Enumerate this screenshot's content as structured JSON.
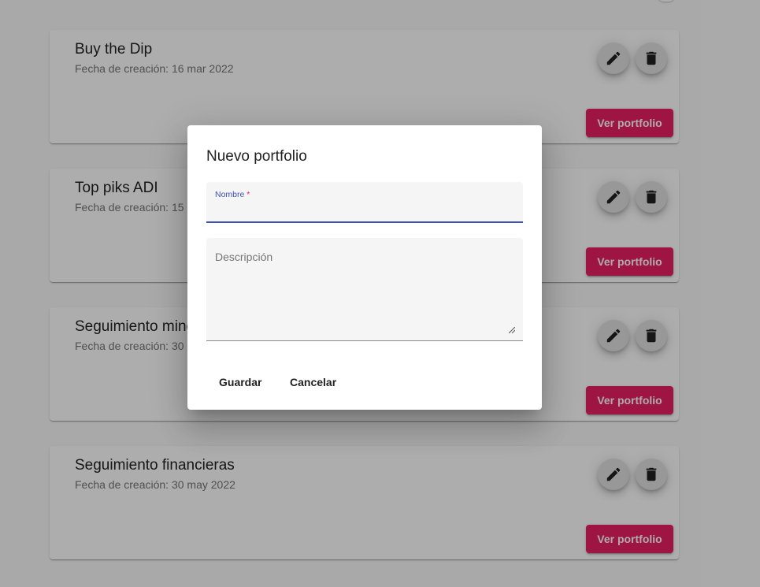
{
  "portfolios": [
    {
      "title": "Buy the Dip",
      "created": "Fecha de creación: 16 mar 2022",
      "view_label": "Ver portfolio"
    },
    {
      "title": "Top piks ADI",
      "created": "Fecha de creación: 15 abr 2022",
      "view_label": "Ver portfolio"
    },
    {
      "title": "Seguimiento mineras",
      "created": "Fecha de creación: 30 may 2022",
      "view_label": "Ver portfolio"
    },
    {
      "title": "Seguimiento financieras",
      "created": "Fecha de creación: 30 may 2022",
      "view_label": "Ver portfolio"
    }
  ],
  "icons": {
    "edit": "pencil-icon",
    "delete": "trash-icon"
  },
  "dialog": {
    "title": "Nuevo portfolio",
    "nombre_label": "Nombre",
    "nombre_required_mark": " *",
    "nombre_value": "",
    "descripcion_placeholder": "Descripción",
    "descripcion_value": "",
    "save_label": "Guardar",
    "cancel_label": "Cancelar"
  },
  "colors": {
    "accent": "#e91e63",
    "primary": "#3f51b5",
    "fab_bg": "#e0e0e0"
  }
}
